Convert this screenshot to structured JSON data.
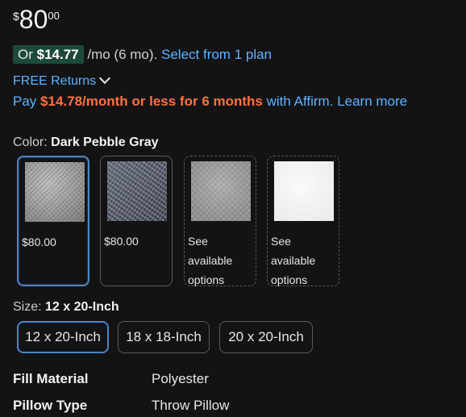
{
  "price": {
    "symbol": "$",
    "whole": "80",
    "fraction": "00"
  },
  "installment": {
    "prefix": "Or",
    "amount": "$14.77",
    "term": "/mo (6 mo).",
    "link": "Select from 1 plan"
  },
  "free_returns": {
    "label": "FREE Returns"
  },
  "affirm": {
    "pay": "Pay",
    "amount": "$14.78/month or less for 6 months",
    "suffix": "with Affirm.",
    "link": "Learn more"
  },
  "color": {
    "label": "Color:",
    "selected": "Dark Pebble Gray",
    "swatches": [
      {
        "label": "$80.00"
      },
      {
        "label": "$80.00"
      },
      {
        "label": "See available options"
      },
      {
        "label": "See available options"
      }
    ]
  },
  "size": {
    "label": "Size:",
    "selected": "12 x 20-Inch",
    "options": [
      "12 x 20-Inch",
      "18 x 18-Inch",
      "20 x 20-Inch"
    ]
  },
  "specs": [
    {
      "key": "Fill Material",
      "value": "Polyester"
    },
    {
      "key": "Pillow Type",
      "value": "Throw Pillow"
    }
  ],
  "colors": {
    "link": "#5eb3ff",
    "affirm_amount": "#ff7043",
    "installment_pill": "#1c4a39",
    "selected_border": "#4b86c6"
  }
}
